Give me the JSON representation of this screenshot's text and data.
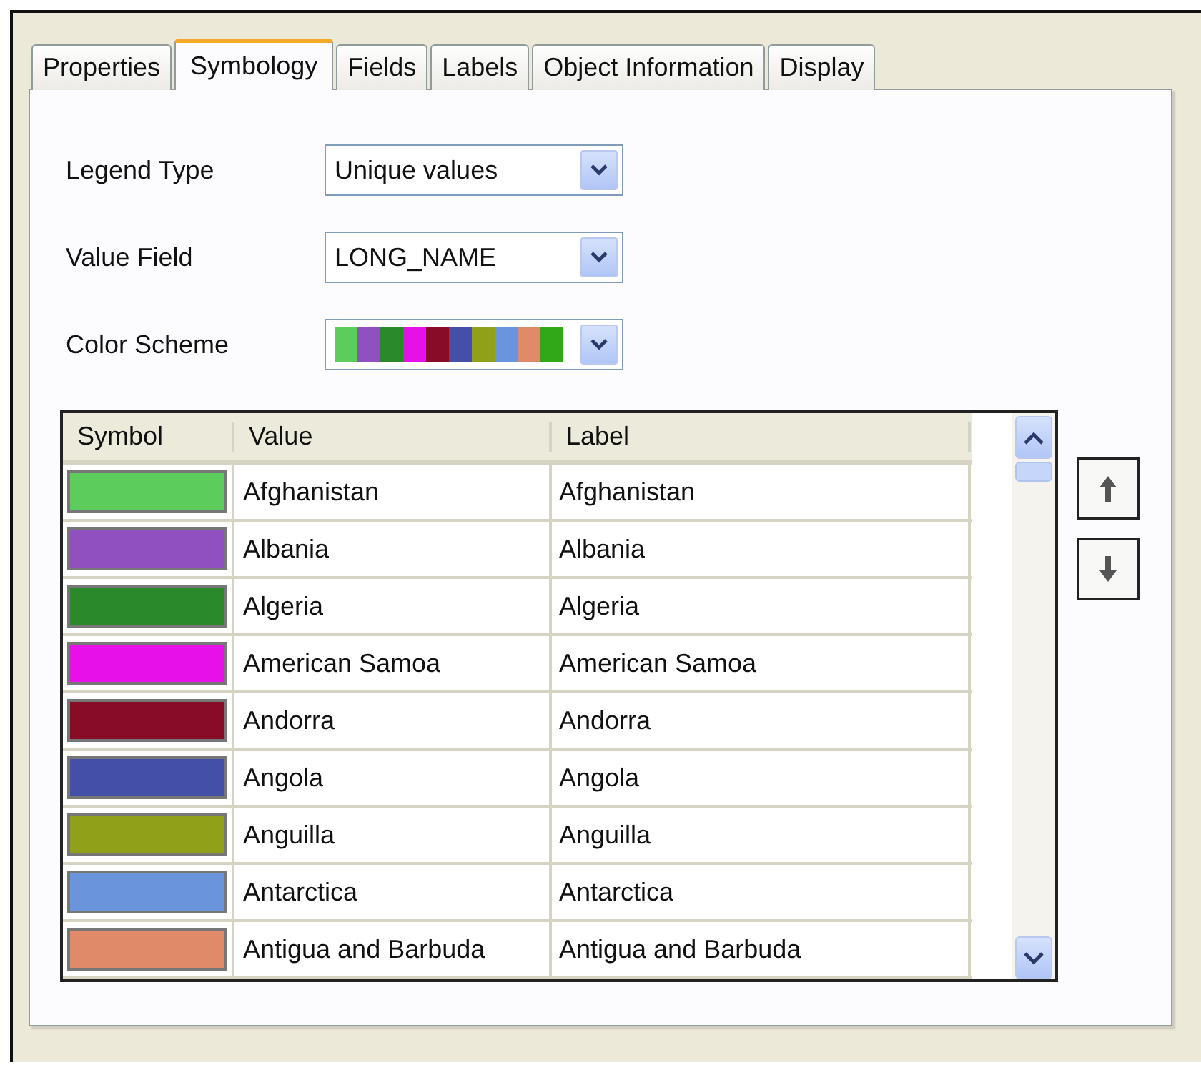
{
  "tabs": [
    {
      "label": "Properties",
      "selected": false
    },
    {
      "label": "Symbology",
      "selected": true
    },
    {
      "label": "Fields",
      "selected": false
    },
    {
      "label": "Labels",
      "selected": false
    },
    {
      "label": "Object Information",
      "selected": false
    },
    {
      "label": "Display",
      "selected": false
    }
  ],
  "form": [
    {
      "label": "Legend Type",
      "kind": "text",
      "value": "Unique values"
    },
    {
      "label": "Value Field",
      "kind": "text",
      "value": "LONG_NAME"
    },
    {
      "label": "Color Scheme",
      "kind": "swatches",
      "swatches": [
        {
          "color": "#5ccc5c"
        },
        {
          "color": "#9050c0"
        },
        {
          "color": "#2a8a2a"
        },
        {
          "color": "#e810e8"
        },
        {
          "color": "#880c28"
        },
        {
          "color": "#4450a8"
        },
        {
          "color": "#90a018"
        },
        {
          "color": "#6a94dc"
        },
        {
          "color": "#e08a6a"
        },
        {
          "color": "#30a818"
        }
      ]
    }
  ],
  "table": {
    "columns": [
      "Symbol",
      "Value",
      "Label"
    ],
    "rows": [
      {
        "color": "#5ccc5c",
        "value": "Afghanistan",
        "label": "Afghanistan"
      },
      {
        "color": "#9050c0",
        "value": "Albania",
        "label": "Albania"
      },
      {
        "color": "#2a8a2a",
        "value": "Algeria",
        "label": "Algeria"
      },
      {
        "color": "#e810e8",
        "value": "American Samoa",
        "label": "American Samoa"
      },
      {
        "color": "#880c28",
        "value": "Andorra",
        "label": "Andorra"
      },
      {
        "color": "#4450a8",
        "value": "Angola",
        "label": "Angola"
      },
      {
        "color": "#90a018",
        "value": "Anguilla",
        "label": "Anguilla"
      },
      {
        "color": "#6a94dc",
        "value": "Antarctica",
        "label": "Antarctica"
      },
      {
        "color": "#e08a6a",
        "value": "Antigua and Barbuda",
        "label": "Antigua and Barbuda"
      }
    ]
  },
  "side_buttons": [
    {
      "kind": "up"
    },
    {
      "kind": "down"
    }
  ]
}
